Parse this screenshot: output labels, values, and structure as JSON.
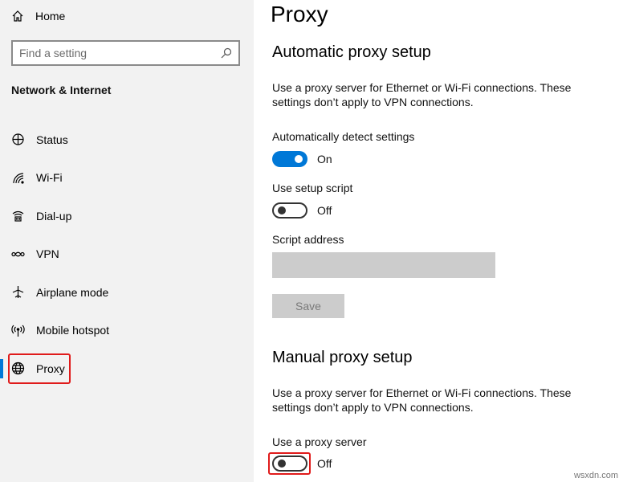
{
  "sidebar": {
    "home_label": "Home",
    "search_placeholder": "Find a setting",
    "section_title": "Network & Internet",
    "items": [
      {
        "label": "Status",
        "icon": "status-icon"
      },
      {
        "label": "Wi-Fi",
        "icon": "wifi-icon"
      },
      {
        "label": "Dial-up",
        "icon": "dialup-icon"
      },
      {
        "label": "VPN",
        "icon": "vpn-icon"
      },
      {
        "label": "Airplane mode",
        "icon": "airplane-icon"
      },
      {
        "label": "Mobile hotspot",
        "icon": "hotspot-icon"
      },
      {
        "label": "Proxy",
        "icon": "globe-icon",
        "active": true
      }
    ]
  },
  "main": {
    "title": "Proxy",
    "automatic": {
      "heading": "Automatic proxy setup",
      "description": "Use a proxy server for Ethernet or Wi-Fi connections. These settings don’t apply to VPN connections.",
      "detect_label": "Automatically detect settings",
      "detect_state": "On",
      "script_label": "Use setup script",
      "script_state": "Off",
      "address_label": "Script address",
      "address_value": "",
      "save_label": "Save"
    },
    "manual": {
      "heading": "Manual proxy setup",
      "description": "Use a proxy server for Ethernet or Wi-Fi connections. These settings don’t apply to VPN connections.",
      "use_proxy_label": "Use a proxy server",
      "use_proxy_state": "Off"
    }
  },
  "watermark": "wsxdn.com",
  "colors": {
    "accent": "#0078d7",
    "highlight": "#e01b1b",
    "sidebar_bg": "#f2f2f2"
  }
}
